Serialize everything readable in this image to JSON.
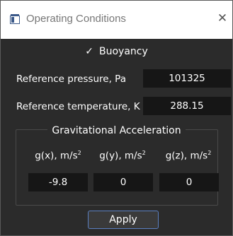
{
  "window": {
    "title": "Operating Conditions",
    "icon": "window-app-icon",
    "close_glyph": "✕"
  },
  "buoyancy": {
    "check_glyph": "✓",
    "label": "Buoyancy",
    "checked": true
  },
  "reference_pressure": {
    "label": "Reference pressure, Pa",
    "value": "101325"
  },
  "reference_temperature": {
    "label": "Reference temperature, K",
    "value": "288.15"
  },
  "gravity": {
    "title": "Gravitational Acceleration",
    "gx": {
      "label": "g(x), m/s",
      "exp": "2",
      "value": "-9.8"
    },
    "gy": {
      "label": "g(y), m/s",
      "exp": "2",
      "value": "0"
    },
    "gz": {
      "label": "g(z), m/s",
      "exp": "2",
      "value": "0"
    }
  },
  "apply_button": {
    "label": "Apply"
  },
  "colors": {
    "background": "#2b2b2b",
    "field": "#161616",
    "accent_border": "#5b7fc0"
  }
}
